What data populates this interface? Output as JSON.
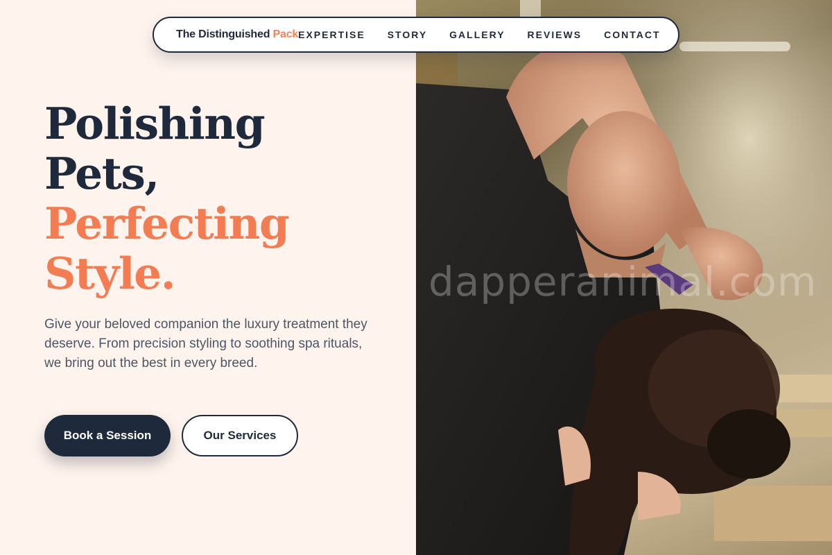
{
  "nav": {
    "brand_main": "The Distinguished",
    "brand_accent": "Pack",
    "links": [
      "EXPERTISE",
      "STORY",
      "GALLERY",
      "REVIEWS",
      "CONTACT"
    ]
  },
  "hero": {
    "title_line1": "Polishing",
    "title_line2": "Pets,",
    "title_line3": "Perfecting",
    "title_line4": "Style.",
    "description": "Give your beloved companion the luxury treatment they deserve. From precision styling to soothing spa rituals, we bring out the best in every breed.",
    "primary_button": "Book a Session",
    "secondary_button": "Our Services"
  },
  "image": {
    "watermark": "dapperanimal.com",
    "subject": "groomer trimming a black poodle with scissors"
  },
  "colors": {
    "navy": "#1e293b",
    "accent": "#f47c53",
    "background": "#fff4ed"
  }
}
